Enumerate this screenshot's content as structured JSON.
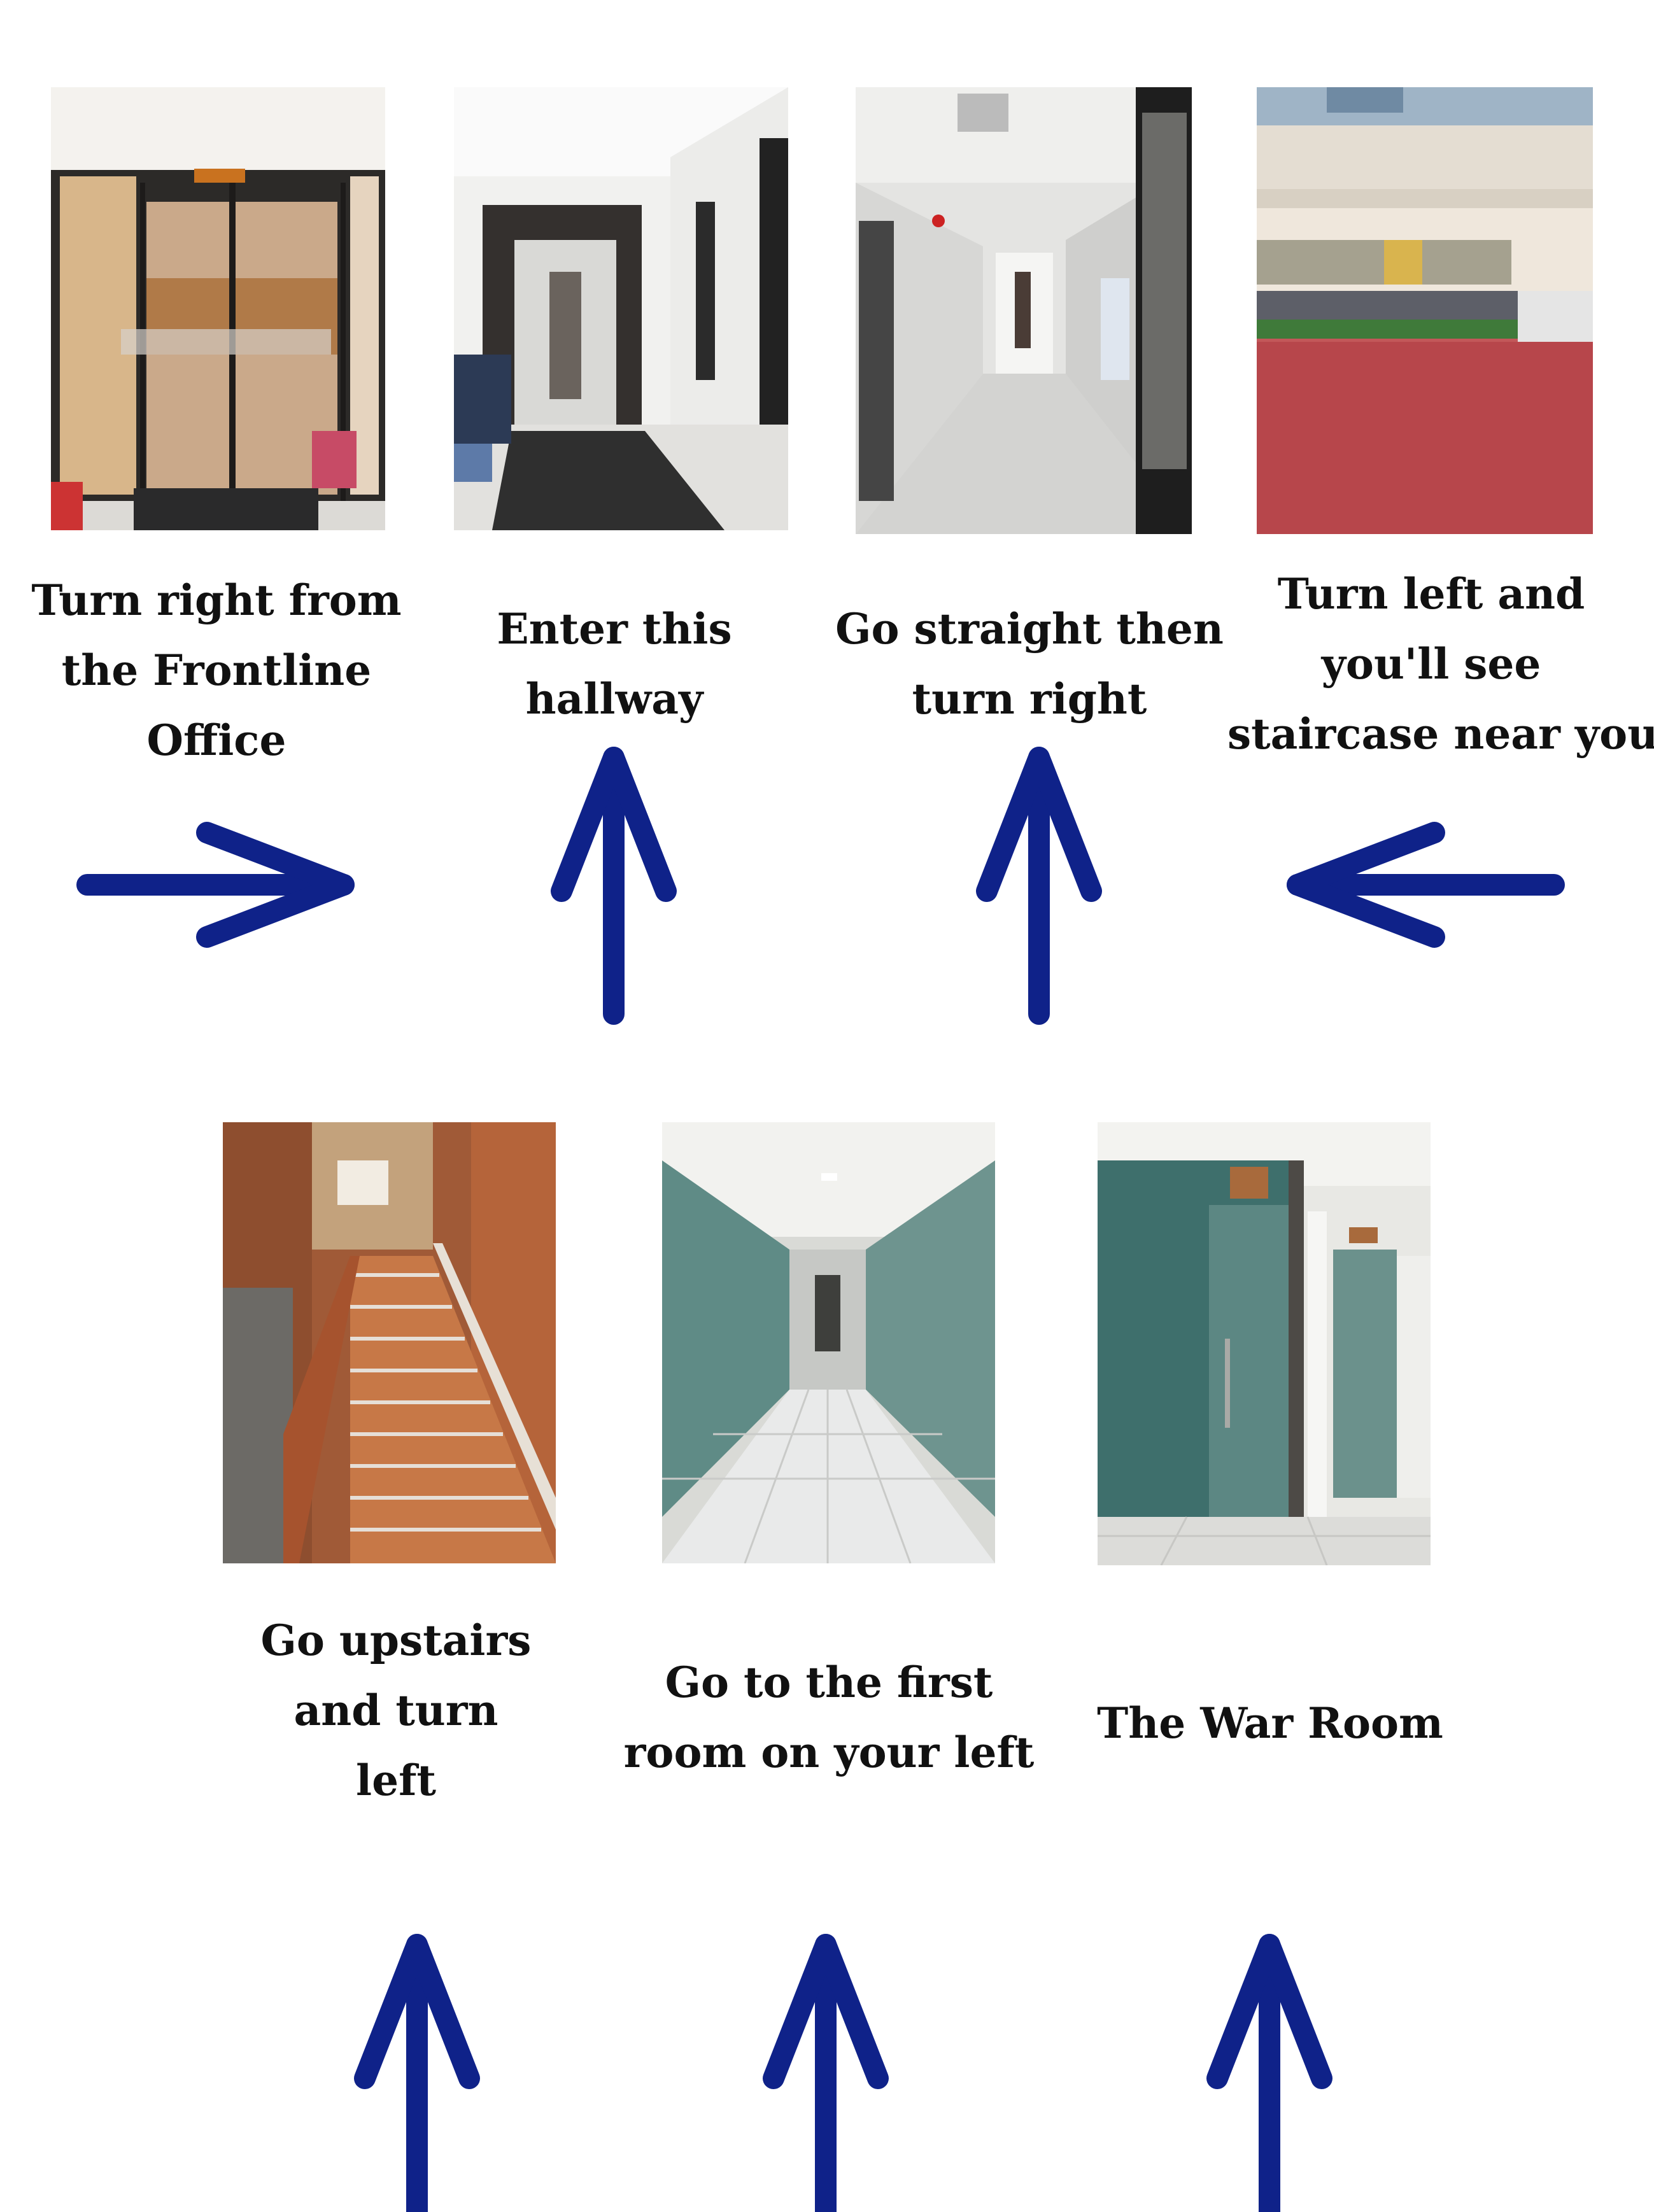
{
  "colors": {
    "arrow": "#0f2289",
    "caption": "#111111",
    "background": "#ffffff"
  },
  "steps": [
    {
      "photo": "frontline-office-glass-door-photo",
      "caption": [
        "Turn right from",
        "the Frontline",
        "Office"
      ],
      "arrow": "right"
    },
    {
      "photo": "hallway-entrance-photo",
      "caption": [
        "Enter this",
        "hallway"
      ],
      "arrow": "up"
    },
    {
      "photo": "straight-corridor-photo",
      "caption": [
        "Go straight then",
        "turn right"
      ],
      "arrow": "up"
    },
    {
      "photo": "courtyard-photo",
      "caption": [
        "Turn left and",
        "you'll see",
        "staircase near you"
      ],
      "arrow": "left"
    },
    {
      "photo": "wooden-staircase-photo",
      "caption": [
        "Go upstairs",
        "and turn",
        "left"
      ],
      "arrow": "up"
    },
    {
      "photo": "glass-walled-corridor-photo",
      "caption": [
        "Go to the first",
        "room on your left"
      ],
      "arrow": "up"
    },
    {
      "photo": "war-room-glass-door-photo",
      "caption": [
        "The War Room"
      ],
      "arrow": "up"
    }
  ]
}
